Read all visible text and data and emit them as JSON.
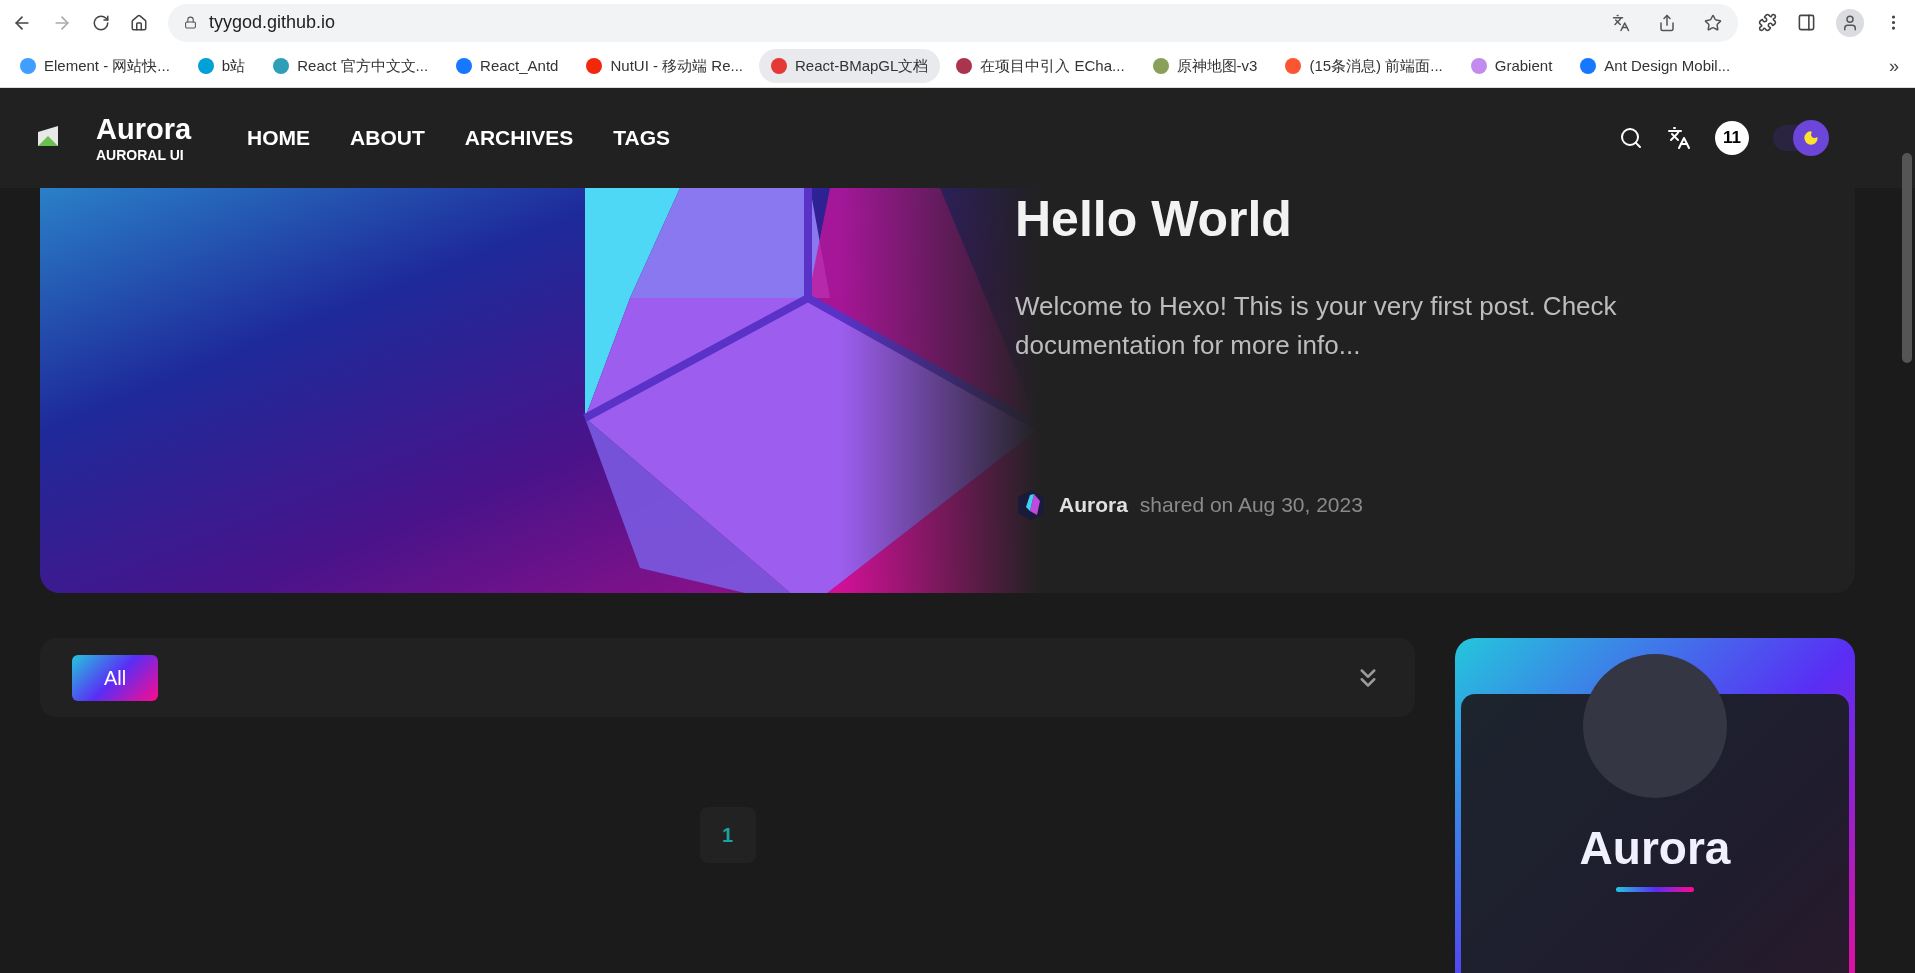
{
  "browser": {
    "url": "tyygod.github.io",
    "bookmarks": [
      {
        "label": "Element - 网站快...",
        "color": "#409eff",
        "selected": false
      },
      {
        "label": "b站",
        "color": "#00a1d6",
        "selected": false
      },
      {
        "label": "React 官方中文文...",
        "color": "#2f9fb8",
        "selected": false
      },
      {
        "label": "React_Antd",
        "color": "#1677ff",
        "selected": false
      },
      {
        "label": "NutUI - 移动端 Re...",
        "color": "#f2270c",
        "selected": false
      },
      {
        "label": "React-BMapGL文档",
        "color": "#e53935",
        "selected": true
      },
      {
        "label": "在项目中引入 ECha...",
        "color": "#aa344d",
        "selected": false
      },
      {
        "label": "原神地图-v3",
        "color": "#8aa05a",
        "selected": false
      },
      {
        "label": "(15条消息) 前端面...",
        "color": "#fc5531",
        "selected": false
      },
      {
        "label": "Grabient",
        "color": "#c38bf0",
        "selected": false
      },
      {
        "label": "Ant Design Mobil...",
        "color": "#1677ff",
        "selected": false
      }
    ],
    "overflow": "»"
  },
  "header": {
    "title": "Aurora",
    "subtitle": "AURORAL UI",
    "nav": [
      {
        "label": "HOME"
      },
      {
        "label": "ABOUT"
      },
      {
        "label": "ARCHIVES"
      },
      {
        "label": "TAGS"
      }
    ],
    "badge": "11",
    "theme_toggle": {
      "on": true
    }
  },
  "hero": {
    "title": "Hello World",
    "excerpt": "Welcome to Hexo! This is your very first post. Check documentation for more info...",
    "author": "Aurora",
    "date": "shared on Aug 30, 2023"
  },
  "categories": [
    {
      "label": "All",
      "selected": true
    }
  ],
  "pagination": [
    {
      "label": "1",
      "selected": true
    }
  ],
  "profile": {
    "name": "Aurora"
  }
}
